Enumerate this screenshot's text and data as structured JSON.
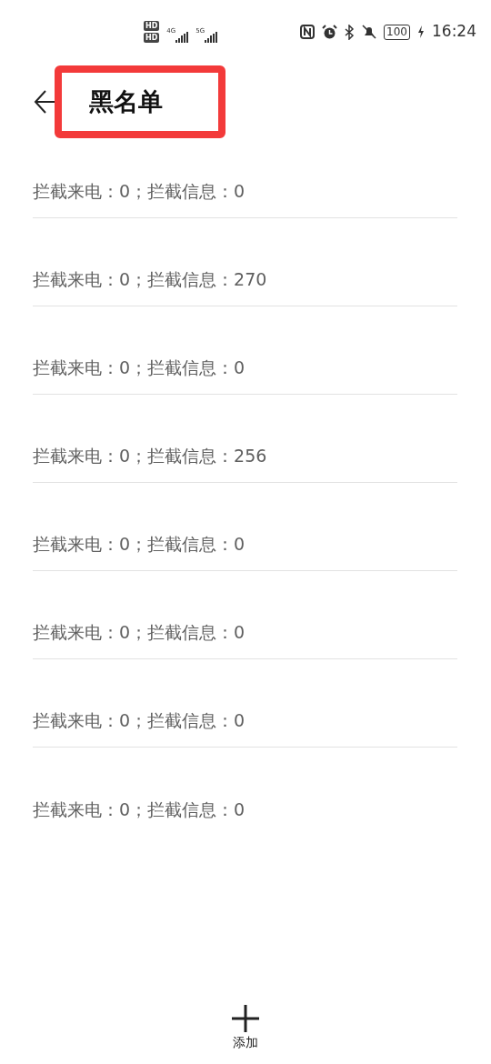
{
  "status_bar": {
    "sim_badges": [
      "HD",
      "HD"
    ],
    "network_types": [
      "4G",
      "5G"
    ],
    "battery": "100",
    "time": "16:24"
  },
  "header": {
    "title": "黑名单",
    "highlighted": true
  },
  "entries": [
    {
      "summary": "拦截来电：0；拦截信息：0"
    },
    {
      "summary": "拦截来电：0；拦截信息：270"
    },
    {
      "summary": "拦截来电：0；拦截信息：0"
    },
    {
      "summary": "拦截来电：0；拦截信息：256"
    },
    {
      "summary": "拦截来电：0；拦截信息：0"
    },
    {
      "summary": "拦截来电：0；拦截信息：0"
    },
    {
      "summary": "拦截来电：0；拦截信息：0"
    },
    {
      "summary": "拦截来电：0；拦截信息：0"
    }
  ],
  "bottom_action": {
    "label": "添加"
  }
}
